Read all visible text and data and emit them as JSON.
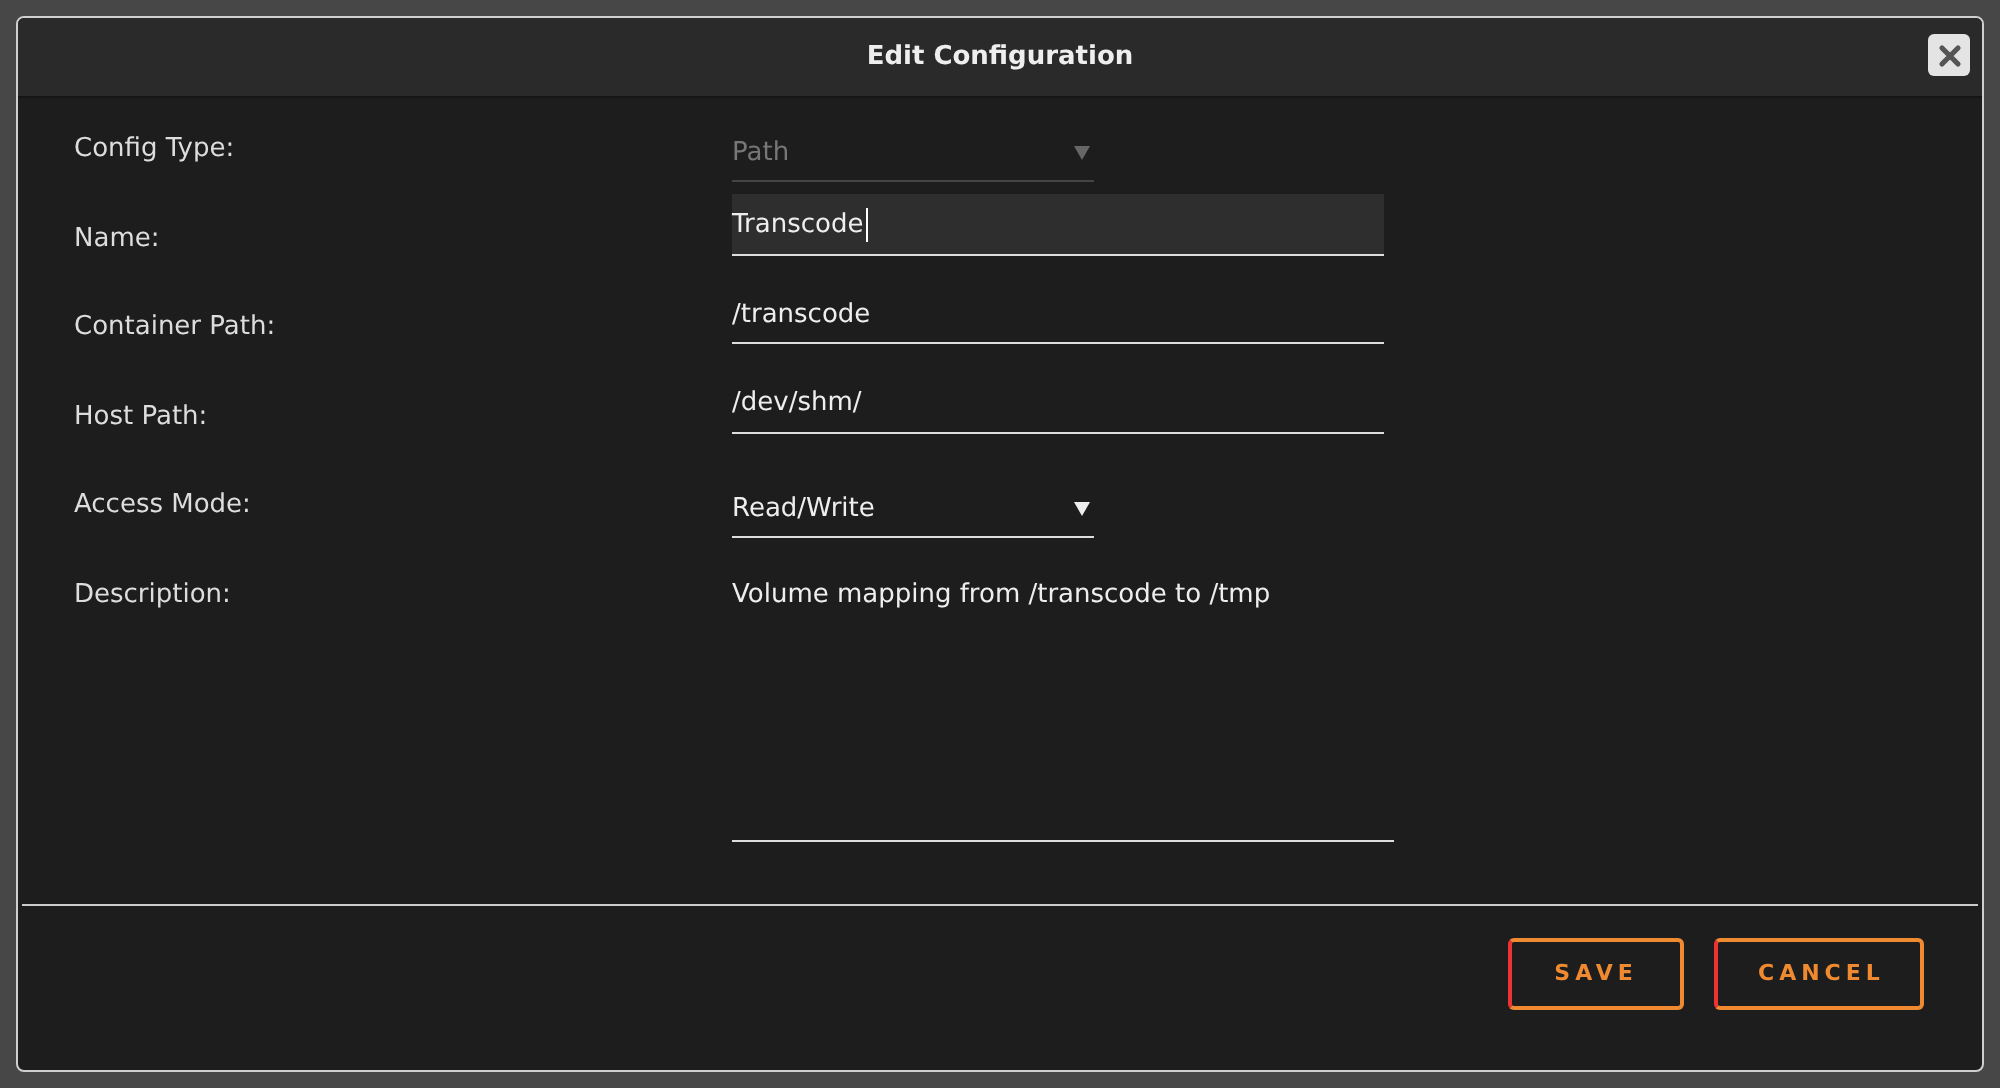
{
  "dialog": {
    "title": "Edit Configuration"
  },
  "fields": [
    {
      "label": "Config Type:",
      "kind": "select",
      "value": "Path",
      "disabled": true
    },
    {
      "label": "Name:",
      "kind": "text",
      "value": "Transcode",
      "focused": true
    },
    {
      "label": "Container Path:",
      "kind": "text",
      "value": "/transcode",
      "focused": false
    },
    {
      "label": "Host Path:",
      "kind": "text",
      "value": "/dev/shm/",
      "focused": false
    },
    {
      "label": "Access Mode:",
      "kind": "select",
      "value": "Read/Write",
      "disabled": false
    },
    {
      "label": "Description:",
      "kind": "textarea",
      "value": "Volume mapping from /transcode to /tmp",
      "focused": false
    }
  ],
  "buttons": [
    "SAVE",
    "CANCEL"
  ]
}
